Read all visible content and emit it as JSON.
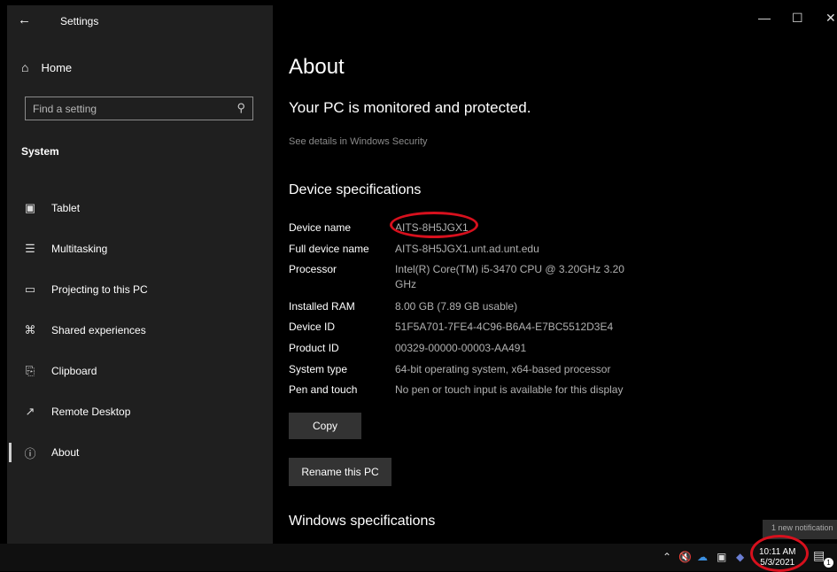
{
  "window": {
    "back_icon": "back-arrow-icon",
    "title": "Settings",
    "controls": {
      "minimize": "—",
      "maximize": "☐",
      "close": "✕"
    }
  },
  "sidebar": {
    "home_label": "Home",
    "search_placeholder": "Find a setting",
    "section": "System",
    "items": [
      {
        "label": "Tablet",
        "icon": "tablet-icon",
        "glyph": "▣"
      },
      {
        "label": "Multitasking",
        "icon": "multitasking-icon",
        "glyph": "☰"
      },
      {
        "label": "Projecting to this PC",
        "icon": "projecting-icon",
        "glyph": "▭"
      },
      {
        "label": "Shared experiences",
        "icon": "shared-experiences-icon",
        "glyph": "⌘"
      },
      {
        "label": "Clipboard",
        "icon": "clipboard-icon",
        "glyph": "⎘"
      },
      {
        "label": "Remote Desktop",
        "icon": "remote-desktop-icon",
        "glyph": "↗"
      },
      {
        "label": "About",
        "icon": "info-icon",
        "glyph": "ⓘ",
        "active": true
      }
    ]
  },
  "main": {
    "title": "About",
    "status": "Your PC is monitored and protected.",
    "security_link": "See details in Windows Security",
    "device_heading": "Device specifications",
    "specs": [
      {
        "label": "Device name",
        "value": "AITS-8H5JGX1"
      },
      {
        "label": "Full device name",
        "value": "AITS-8H5JGX1.unt.ad.unt.edu"
      },
      {
        "label": "Processor",
        "value": "Intel(R) Core(TM) i5-3470 CPU @ 3.20GHz   3.20",
        "value2": "GHz"
      },
      {
        "label": "Installed RAM",
        "value": "8.00 GB (7.89 GB usable)"
      },
      {
        "label": "Device ID",
        "value": "51F5A701-7FE4-4C96-B6A4-E7BC5512D3E4"
      },
      {
        "label": "Product ID",
        "value": "00329-00000-00003-AA491"
      },
      {
        "label": "System type",
        "value": "64-bit operating system, x64-based processor"
      },
      {
        "label": "Pen and touch",
        "value": "No pen or touch input is available for this display"
      }
    ],
    "copy_button": "Copy",
    "rename_button": "Rename this PC",
    "windows_heading": "Windows specifications"
  },
  "taskbar": {
    "time": "10:11 AM",
    "date": "5/3/2021",
    "notification_toast": "1 new notification",
    "notification_count": "1"
  },
  "colors": {
    "annotation": "#d7101d",
    "sidebar_bg": "#1f1f1f",
    "button_bg": "#333333"
  }
}
